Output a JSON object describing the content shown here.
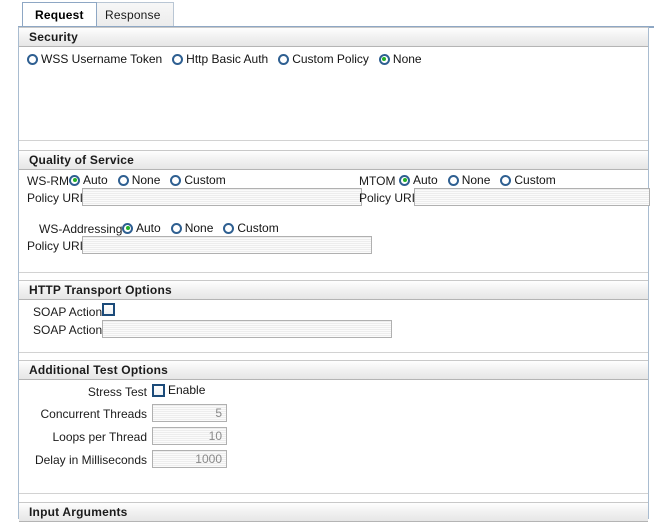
{
  "tabs": [
    {
      "label": "Request",
      "active": true
    },
    {
      "label": "Response",
      "active": false
    }
  ],
  "sections": {
    "security": {
      "title": "Security",
      "options": [
        {
          "label": "WSS Username Token",
          "selected": false
        },
        {
          "label": "Http Basic Auth",
          "selected": false
        },
        {
          "label": "Custom Policy",
          "selected": false
        },
        {
          "label": "None",
          "selected": true
        }
      ]
    },
    "qos": {
      "title": "Quality of Service",
      "wsrm": {
        "label": "WS-RM",
        "options": [
          {
            "label": "Auto",
            "selected": true
          },
          {
            "label": "None",
            "selected": false
          },
          {
            "label": "Custom",
            "selected": false
          }
        ],
        "policy_uri_label": "Policy URI",
        "policy_uri_value": ""
      },
      "mtom": {
        "label": "MTOM",
        "options": [
          {
            "label": "Auto",
            "selected": true
          },
          {
            "label": "None",
            "selected": false
          },
          {
            "label": "Custom",
            "selected": false
          }
        ],
        "policy_uri_label": "Policy URI",
        "policy_uri_value": ""
      },
      "wsaddressing": {
        "label": "WS-Addressing",
        "options": [
          {
            "label": "Auto",
            "selected": true
          },
          {
            "label": "None",
            "selected": false
          },
          {
            "label": "Custom",
            "selected": false
          }
        ],
        "policy_uri_label": "Policy URI",
        "policy_uri_value": ""
      }
    },
    "http_transport": {
      "title": "HTTP Transport Options",
      "soap_action_checkbox_label": "SOAP Action",
      "soap_action_checked": false,
      "soap_action_field_label": "SOAP Action",
      "soap_action_field_value": ""
    },
    "additional_test": {
      "title": "Additional Test Options",
      "stress_test_label": "Stress Test",
      "enable_label": "Enable",
      "enable_checked": false,
      "rows": [
        {
          "label": "Concurrent Threads",
          "value": "5"
        },
        {
          "label": "Loops per Thread",
          "value": "10"
        },
        {
          "label": "Delay in Milliseconds",
          "value": "1000"
        }
      ]
    },
    "input_arguments": {
      "title": "Input Arguments"
    }
  },
  "colors": {
    "accent": "#2e5f91",
    "radio_selected_dot": "#22b128",
    "checkbox_border": "#1b4a79",
    "tab_border": "#8ea7c4"
  }
}
